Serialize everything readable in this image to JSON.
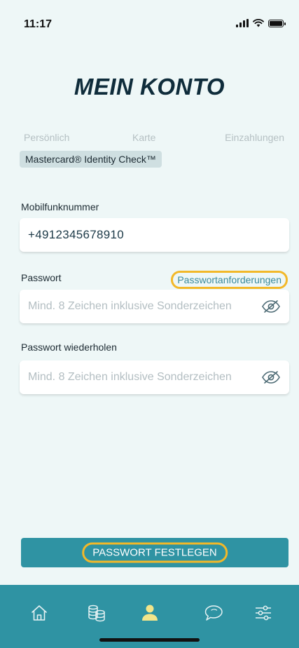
{
  "status_bar": {
    "time": "11:17"
  },
  "page": {
    "title": "MEIN KONTO"
  },
  "tabs": [
    {
      "label": "Persönlich"
    },
    {
      "label": "Karte"
    },
    {
      "label": "Einzahlungen"
    }
  ],
  "active_chip": {
    "label": "Mastercard® Identity Check™"
  },
  "form": {
    "mobile": {
      "label": "Mobilfunknummer",
      "value": "+4912345678910"
    },
    "password": {
      "label": "Passwort",
      "requirements_link": "Passwortanforderungen",
      "placeholder": "Mind. 8 Zeichen inklusive Sonderzeichen",
      "icon": "eye-slash-icon"
    },
    "password_repeat": {
      "label": "Passwort wiederholen",
      "placeholder": "Mind. 8 Zeichen inklusive Sonderzeichen",
      "icon": "eye-slash-icon"
    }
  },
  "actions": {
    "set_password": "PASSWORT FESTLEGEN"
  },
  "bottom_nav": {
    "items": [
      {
        "icon": "home-icon",
        "active": false
      },
      {
        "icon": "coins-icon",
        "active": false
      },
      {
        "icon": "profile-icon",
        "active": true
      },
      {
        "icon": "chat-icon",
        "active": false
      },
      {
        "icon": "settings-sliders-icon",
        "active": false
      }
    ]
  },
  "colors": {
    "background": "#eef7f7",
    "accent": "#2f93a3",
    "highlight": "#f2b829",
    "active_nav": "#f3e58a",
    "title": "#0f2c3b"
  }
}
